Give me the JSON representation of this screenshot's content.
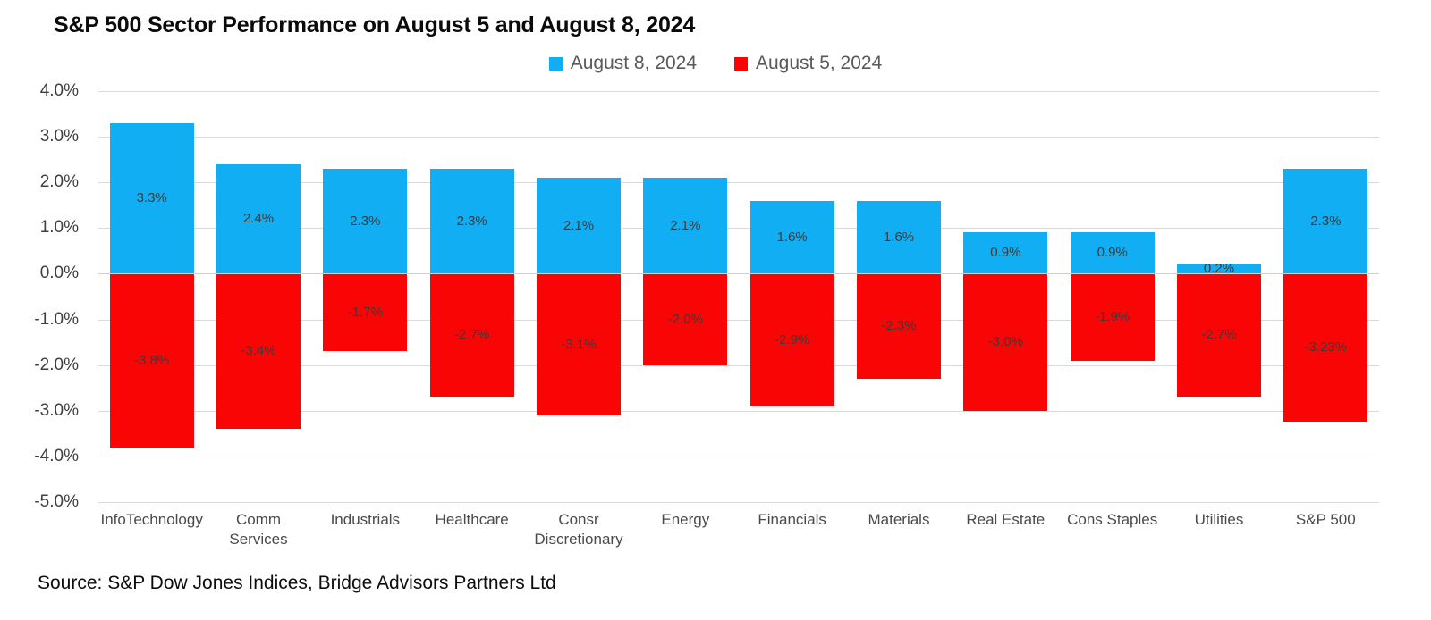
{
  "title": "S&P 500 Sector Performance on August 5 and August 8, 2024",
  "source": "Source: S&P Dow Jones Indices, Bridge Advisors Partners Ltd",
  "legend": [
    {
      "label": "August 8, 2024",
      "color": "#12AEF3"
    },
    {
      "label": "August 5, 2024",
      "color": "#FA0505"
    }
  ],
  "colors": {
    "series_aug8": "#12AEF3",
    "series_aug5": "#FA0505",
    "gridline": "#d9d9d9",
    "title_text": "#0a0a0a",
    "axis_text": "#4a4a4a",
    "legend_text": "#595959"
  },
  "chart_data": {
    "type": "bar",
    "title": "S&P 500 Sector Performance on August 5 and August 8, 2024",
    "xlabel": "",
    "ylabel": "",
    "ylim": [
      -5.0,
      4.0
    ],
    "ytick_labels": [
      "4.0%",
      "3.0%",
      "2.0%",
      "1.0%",
      "0.0%",
      "-1.0%",
      "-2.0%",
      "-3.0%",
      "-4.0%",
      "-5.0%"
    ],
    "ytick_values": [
      4.0,
      3.0,
      2.0,
      1.0,
      0.0,
      -1.0,
      -2.0,
      -3.0,
      -4.0,
      -5.0
    ],
    "grid": true,
    "legend_position": "top-center",
    "stacked_overlay": true,
    "categories": [
      "InfoTechnology",
      "Comm Services",
      "Industrials",
      "Healthcare",
      "Consr Discretionary",
      "Energy",
      "Financials",
      "Materials",
      "Real Estate",
      "Cons Staples",
      "Utilities",
      "S&P 500"
    ],
    "category_lines": [
      [
        "InfoTechnology"
      ],
      [
        "Comm Services"
      ],
      [
        "Industrials"
      ],
      [
        "Healthcare"
      ],
      [
        "Consr",
        "Discretionary"
      ],
      [
        "Energy"
      ],
      [
        "Financials"
      ],
      [
        "Materials"
      ],
      [
        "Real Estate"
      ],
      [
        "Cons Staples"
      ],
      [
        "Utilities"
      ],
      [
        "S&P 500"
      ]
    ],
    "series": [
      {
        "name": "August 8, 2024",
        "color": "#12AEF3",
        "values": [
          3.3,
          2.4,
          2.3,
          2.3,
          2.1,
          2.1,
          1.6,
          1.6,
          0.9,
          0.9,
          0.2,
          2.3
        ],
        "labels": [
          "3.3%",
          "2.4%",
          "2.3%",
          "2.3%",
          "2.1%",
          "2.1%",
          "1.6%",
          "1.6%",
          "0.9%",
          "0.9%",
          "0.2%",
          "2.3%"
        ]
      },
      {
        "name": "August 5, 2024",
        "color": "#FA0505",
        "values": [
          -3.8,
          -3.4,
          -1.7,
          -2.7,
          -3.1,
          -2.0,
          -2.9,
          -2.3,
          -3.0,
          -1.9,
          -2.7,
          -3.23
        ],
        "labels": [
          "-3.8%",
          "-3.4%",
          "-1.7%",
          "-2.7%",
          "-3.1%",
          "-2.0%",
          "-2.9%",
          "-2.3%",
          "-3.0%",
          "-1.9%",
          "-2.7%",
          "-3.23%"
        ]
      }
    ]
  }
}
